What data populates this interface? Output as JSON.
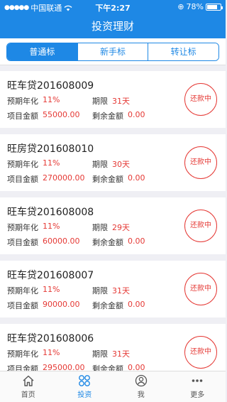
{
  "status_bar": {
    "carrier": "中国联通",
    "time": "下午2:27",
    "battery": "78%",
    "battery_level": 0.78
  },
  "header": {
    "title": "投资理财"
  },
  "tabs": [
    {
      "label": "普通标",
      "active": true
    },
    {
      "label": "新手标",
      "active": false
    },
    {
      "label": "转让标",
      "active": false
    }
  ],
  "items": [
    {
      "title": "旺车贷201608009",
      "rate_label": "预期年化",
      "rate": "11%",
      "term_label": "期限",
      "term": "31天",
      "amount_label": "项目金额",
      "amount": "55000.00",
      "remain_label": "剩余金额",
      "remain": "0.00",
      "status": "还款中"
    },
    {
      "title": "旺房贷201608010",
      "rate_label": "预期年化",
      "rate": "11%",
      "term_label": "期限",
      "term": "30天",
      "amount_label": "项目金额",
      "amount": "270000.00",
      "remain_label": "剩余金额",
      "remain": "0.00",
      "status": "还款中"
    },
    {
      "title": "旺车贷201608008",
      "rate_label": "预期年化",
      "rate": "11%",
      "term_label": "期限",
      "term": "29天",
      "amount_label": "项目金额",
      "amount": "60000.00",
      "remain_label": "剩余金额",
      "remain": "0.00",
      "status": "还款中"
    },
    {
      "title": "旺车贷201608007",
      "rate_label": "预期年化",
      "rate": "11%",
      "term_label": "期限",
      "term": "31天",
      "amount_label": "项目金额",
      "amount": "90000.00",
      "remain_label": "剩余金额",
      "remain": "0.00",
      "status": "还款中"
    },
    {
      "title": "旺车贷201608006",
      "rate_label": "预期年化",
      "rate": "11%",
      "term_label": "期限",
      "term": "31天",
      "amount_label": "项目金额",
      "amount": "295000.00",
      "remain_label": "剩余金额",
      "remain": "0.00",
      "status": "还款中"
    }
  ],
  "tabbar": [
    {
      "label": "首页",
      "icon": "home-icon",
      "active": false
    },
    {
      "label": "投资",
      "icon": "invest-icon",
      "active": true
    },
    {
      "label": "我",
      "icon": "user-icon",
      "active": false
    },
    {
      "label": "更多",
      "icon": "more-icon",
      "active": false
    }
  ],
  "colors": {
    "primary": "#1e88e5",
    "accent_red": "#e53935",
    "background": "#efeff4"
  }
}
